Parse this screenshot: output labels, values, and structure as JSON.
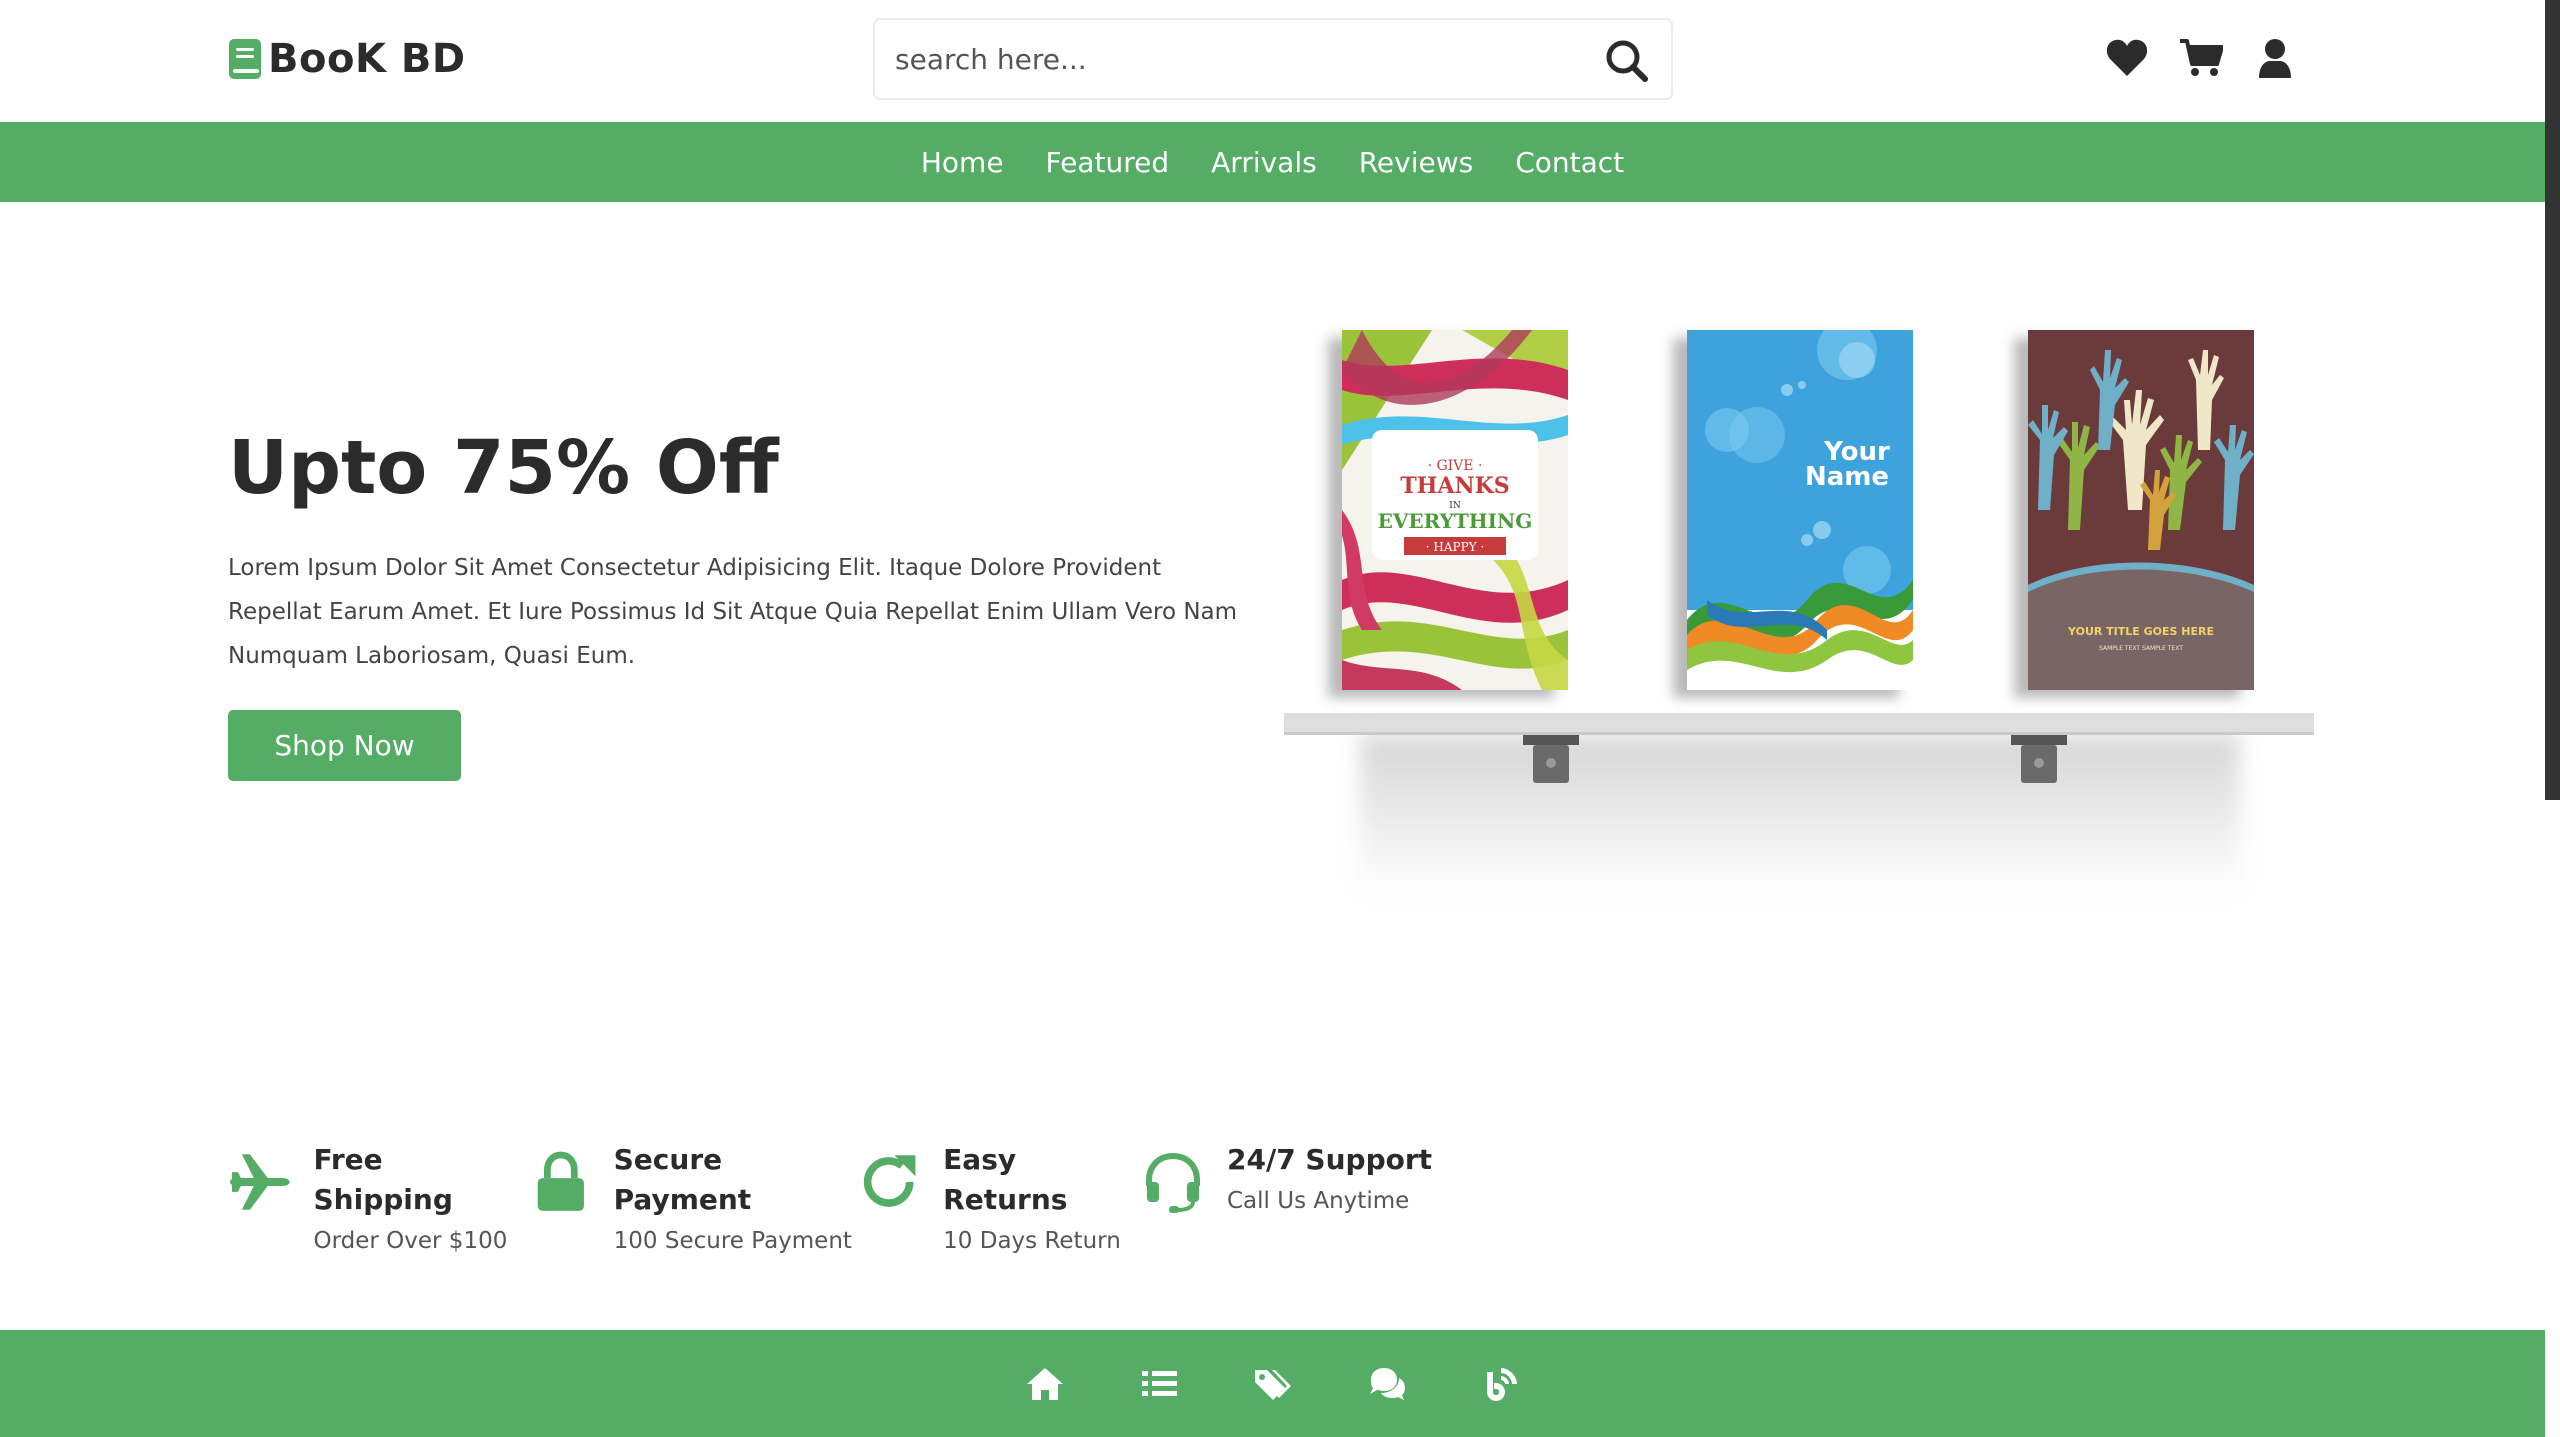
{
  "brand": {
    "name": "BooK BD"
  },
  "search": {
    "placeholder": "search here..."
  },
  "header_icons": [
    "heart-icon",
    "cart-icon",
    "user-icon"
  ],
  "nav": {
    "items": [
      {
        "label": "Home"
      },
      {
        "label": "Featured"
      },
      {
        "label": "Arrivals"
      },
      {
        "label": "Reviews"
      },
      {
        "label": "Contact"
      }
    ]
  },
  "hero": {
    "title": "Upto 75% Off",
    "text": "Lorem Ipsum Dolor Sit Amet Consectetur Adipisicing Elit. Itaque Dolore Provident Repellat Earum Amet. Et Iure Possimus Id Sit Atque Quia Repellat Enim Ullam Vero Nam Numquam Laboriosam, Quasi Eum.",
    "button": "Shop Now"
  },
  "books": [
    {
      "cover_lines": [
        "GIVE",
        "THANKS",
        "IN",
        "EVERYTHING",
        "HAPPY"
      ]
    },
    {
      "cover_lines": [
        "Your",
        "Name"
      ]
    },
    {
      "cover_lines": [
        "YOUR TITLE GOES HERE",
        "SAMPLE TEXT SAMPLE TEXT"
      ]
    }
  ],
  "features": [
    {
      "icon": "plane-icon",
      "title": "Free Shipping",
      "subtitle": "Order Over $100"
    },
    {
      "icon": "lock-icon",
      "title": "Secure Payment",
      "subtitle": "100 Secure Payment"
    },
    {
      "icon": "redo-icon",
      "title": "Easy Returns",
      "subtitle": "10 Days Return"
    },
    {
      "icon": "headset-icon",
      "title": "24/7 Support",
      "subtitle": "Call Us Anytime"
    }
  ],
  "bottom_nav_icons": [
    "home-icon",
    "list-icon",
    "tags-icon",
    "comments-icon",
    "blog-icon"
  ],
  "colors": {
    "accent": "#55ac65",
    "text": "#2b2b2b"
  }
}
